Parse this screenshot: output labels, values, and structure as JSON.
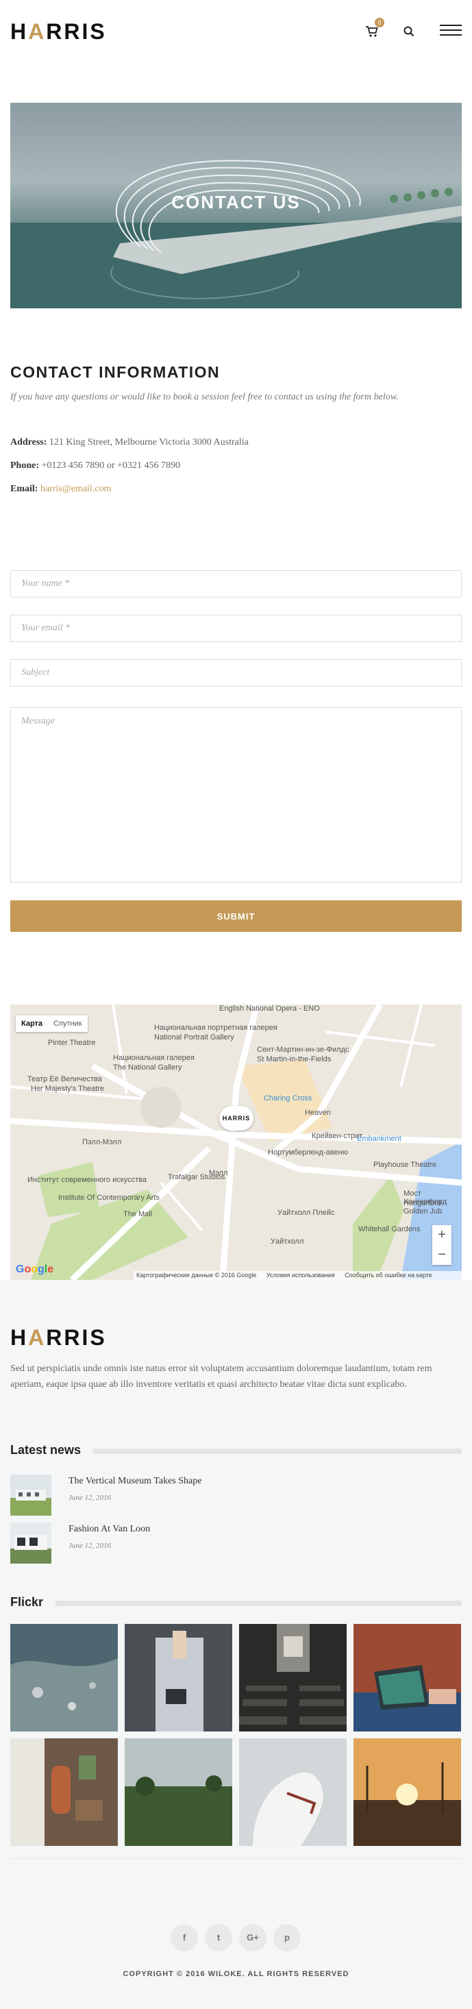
{
  "header": {
    "logo_prefix": "H",
    "logo_accent": "A",
    "logo_suffix": "RRIS",
    "cart_count": "0",
    "cart_icon": "cart-icon",
    "search_icon": "search-icon",
    "menu_icon": "hamburger-menu-icon"
  },
  "hero": {
    "title": "CONTACT US"
  },
  "contact": {
    "title": "CONTACT INFORMATION",
    "subtitle": "If you have any questions or would like to book a session feel free to contact us using the form below.",
    "address_label": "Address:",
    "address_value": "121 King Street, Melbourne Victoria 3000 Australia",
    "phone_label": "Phone:",
    "phone_value": "+0123 456 7890 or +0321 456 7890",
    "email_label": "Email:",
    "email_value": "harris@email.com"
  },
  "form": {
    "name_placeholder": "Your name *",
    "email_placeholder": "Your email *",
    "subject_placeholder": "Subject",
    "message_placeholder": "Message",
    "submit_label": "SUBMIT"
  },
  "map": {
    "tab_map": "Карта",
    "tab_satellite": "Спутник",
    "marker_label": "HARRIS",
    "labels": [
      "English National Opera - ENO",
      "Национальная портретная галерея",
      "National Portrait Gallery",
      "Национальная галерея",
      "The National Gallery",
      "Сент-Мартин-ин-зе-Филдс",
      "St Martin-in-the-Fields",
      "Театр Её Величества",
      "Her Majesty's Theatre",
      "Pinter Theatre",
      "Charing Cross",
      "Heaven",
      "Embankment",
      "Playhouse Theatre",
      "Институт современного искусства",
      "Institute Of Contemporary Arts",
      "Trafalgar Studios",
      "Мост Хангерфорд",
      "Hungerford Golden Jub",
      "Whitehall Gardens",
      "Уайтхолл Плейс",
      "Нортумберленд-авеню",
      "The Mall",
      "Мэлл",
      "Пэлл-Мэлл",
      "Крейвен-стрит",
      "Уайтхолл"
    ],
    "google_logo": "Google",
    "footer_data": "Картографические данные © 2016 Google",
    "footer_terms": "Условия использования",
    "footer_report": "Сообщить об ошибке на карте",
    "zoom_in": "+",
    "zoom_out": "−"
  },
  "footer": {
    "logo_prefix": "H",
    "logo_accent": "A",
    "logo_suffix": "RRIS",
    "about": "Sed ut perspiciatis unde omnis iste natus error sit voluptatem accusantium doloremque laudantium, totam rem aperiam, eaque ipsa quae ab illo inventore veritatis et quasi architecto beatae vitae dicta sunt explicabo.",
    "news_title": "Latest news",
    "news": [
      {
        "title": "The Vertical Museum Takes Shape",
        "date": "June 12, 2016"
      },
      {
        "title": "Fashion At Van Loon",
        "date": "June 12, 2016"
      }
    ],
    "flickr_title": "Flickr",
    "social": [
      {
        "icon": "facebook-icon",
        "glyph": "f"
      },
      {
        "icon": "twitter-icon",
        "glyph": "t"
      },
      {
        "icon": "google-plus-icon",
        "glyph": "G+"
      },
      {
        "icon": "pinterest-icon",
        "glyph": "p"
      }
    ],
    "copyright": "COPYRIGHT © 2016 WILOKE. ALL RIGHTS RESERVED"
  },
  "colors": {
    "accent": "#c49a56",
    "text_dark": "#222222",
    "footer_bg": "#f5f6f6"
  }
}
